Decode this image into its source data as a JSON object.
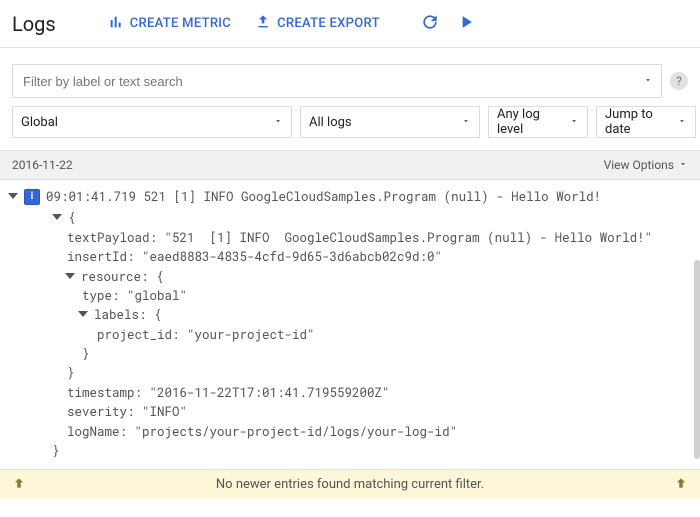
{
  "header": {
    "title": "Logs",
    "create_metric": "CREATE METRIC",
    "create_export": "CREATE EXPORT"
  },
  "filter": {
    "placeholder": "Filter by label or text search"
  },
  "dropdowns": {
    "scope": "Global",
    "logs": "All logs",
    "level": "Any log level",
    "jump": "Jump to date"
  },
  "datebar": {
    "date": "2016-11-22",
    "view_options": "View Options"
  },
  "entry": {
    "summary": "09:01:41.719 521 [1] INFO GoogleCloudSamples.Program (null) - Hello World!",
    "lines": {
      "open": "{",
      "textPayload": "  textPayload: \"521  [1] INFO  GoogleCloudSamples.Program (null) - Hello World!\"",
      "insertId": "  insertId: \"eaed8883-4835-4cfd-9d65-3d6abcb02c9d:0\"",
      "resource": "resource: {",
      "type": "    type: \"global\"",
      "labels": "labels: {",
      "project": "      project_id: \"your-project-id\"",
      "labelsClose": "    }",
      "resClose": "  }",
      "timestamp": "  timestamp: \"2016-11-22T17:01:41.719559200Z\"",
      "severity": "  severity: \"INFO\"",
      "logName": "  logName: \"projects/your-project-id/logs/your-log-id\"",
      "close": "}"
    }
  },
  "notice": {
    "text": "No newer entries found matching current filter."
  }
}
